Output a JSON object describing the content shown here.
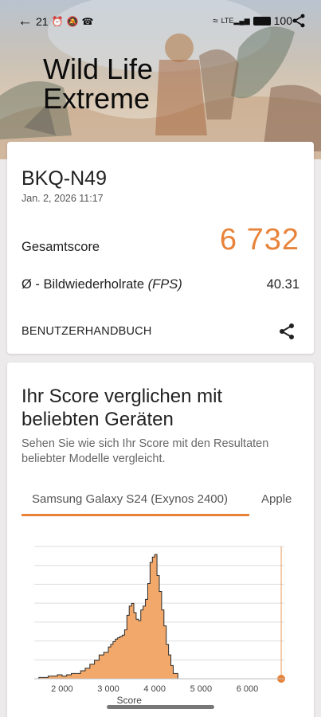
{
  "status_bar": {
    "time": "21",
    "battery": "100"
  },
  "hero": {
    "title_line1": "Wild Life",
    "title_line2": "Extreme"
  },
  "result": {
    "device": "BKQ-N49",
    "date": "Jan. 2, 2026 11:17",
    "total_label": "Gesamtscore",
    "total_value": "6 732",
    "fps_label_prefix": "Ø - Bildwiederholrate ",
    "fps_label_unit": "(FPS)",
    "fps_value": "40.31",
    "manual_label": "BENUTZERHANDBUCH"
  },
  "compare": {
    "title": "Ihr Score verglichen mit beliebten Geräten",
    "subtitle": "Sehen Sie wie sich Ihr Score mit den Resultaten beliebter Modelle vergleicht.",
    "tabs": [
      "Samsung Galaxy S24 (Exynos 2400)",
      "Apple"
    ]
  },
  "colors": {
    "accent": "#e8833a",
    "histogram_fill": "#f2a86a"
  },
  "chart_data": {
    "type": "area",
    "xlabel": "Score",
    "ylabel": "",
    "x_ticks": [
      "2 000",
      "3 000",
      "4 000",
      "5 000",
      "6 000"
    ],
    "xlim": [
      1400,
      6800
    ],
    "ylim": [
      0,
      100
    ],
    "marker_value": 6732,
    "x": [
      1400,
      1500,
      1600,
      1700,
      1800,
      1900,
      2000,
      2100,
      2200,
      2300,
      2400,
      2500,
      2600,
      2700,
      2800,
      2900,
      3000,
      3050,
      3100,
      3150,
      3200,
      3250,
      3300,
      3350,
      3400,
      3450,
      3500,
      3550,
      3600,
      3650,
      3700,
      3750,
      3800,
      3850,
      3900,
      3950,
      4000,
      4050,
      4100,
      4150,
      4200,
      4250,
      4300,
      4350,
      4400,
      4500
    ],
    "values": [
      0,
      1,
      1,
      2,
      2,
      3,
      2,
      3,
      4,
      4,
      6,
      8,
      11,
      14,
      18,
      20,
      24,
      26,
      28,
      30,
      31,
      32,
      33,
      37,
      48,
      55,
      57,
      50,
      45,
      44,
      52,
      55,
      60,
      72,
      88,
      92,
      94,
      78,
      66,
      52,
      40,
      26,
      18,
      10,
      4,
      0
    ]
  }
}
